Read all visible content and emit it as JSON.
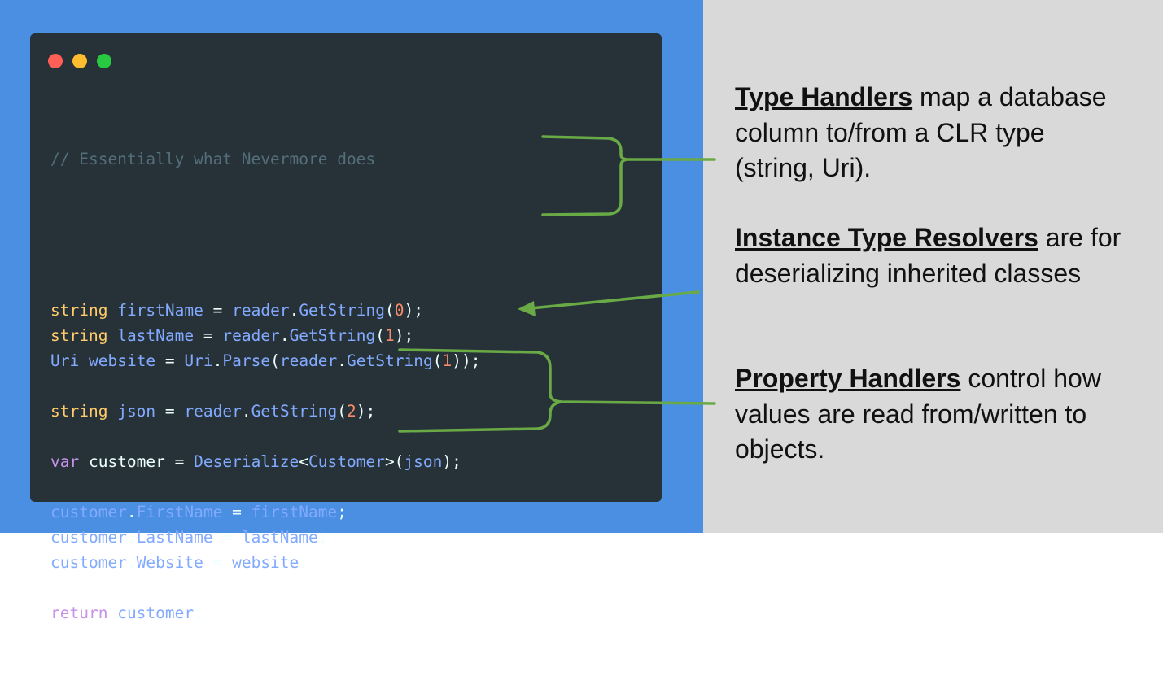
{
  "colors": {
    "left_bg": "#4a8fe2",
    "right_bg": "#d9d9d9",
    "code_bg": "#263238",
    "arrow": "#6aaa46"
  },
  "window_controls": [
    "close",
    "minimize",
    "maximize"
  ],
  "code": {
    "comment": "// Essentially what Nevermore does",
    "lines": [
      [
        [
          "t-type",
          "string"
        ],
        [
          "t-punc",
          " "
        ],
        [
          "t-var",
          "firstName"
        ],
        [
          "t-punc",
          " = "
        ],
        [
          "t-var",
          "reader"
        ],
        [
          "t-punc",
          "."
        ],
        [
          "t-fn",
          "GetString"
        ],
        [
          "t-punc",
          "("
        ],
        [
          "t-num",
          "0"
        ],
        [
          "t-punc",
          ");"
        ]
      ],
      [
        [
          "t-type",
          "string"
        ],
        [
          "t-punc",
          " "
        ],
        [
          "t-var",
          "lastName"
        ],
        [
          "t-punc",
          " = "
        ],
        [
          "t-var",
          "reader"
        ],
        [
          "t-punc",
          "."
        ],
        [
          "t-fn",
          "GetString"
        ],
        [
          "t-punc",
          "("
        ],
        [
          "t-num",
          "1"
        ],
        [
          "t-punc",
          ");"
        ]
      ],
      [
        [
          "t-var",
          "Uri"
        ],
        [
          "t-punc",
          " "
        ],
        [
          "t-var",
          "website"
        ],
        [
          "t-punc",
          " = "
        ],
        [
          "t-var",
          "Uri"
        ],
        [
          "t-punc",
          "."
        ],
        [
          "t-fn",
          "Parse"
        ],
        [
          "t-punc",
          "("
        ],
        [
          "t-var",
          "reader"
        ],
        [
          "t-punc",
          "."
        ],
        [
          "t-fn",
          "GetString"
        ],
        [
          "t-punc",
          "("
        ],
        [
          "t-num",
          "1"
        ],
        [
          "t-punc",
          "));"
        ]
      ],
      [],
      [
        [
          "t-type",
          "string"
        ],
        [
          "t-punc",
          " "
        ],
        [
          "t-var",
          "json"
        ],
        [
          "t-punc",
          " = "
        ],
        [
          "t-var",
          "reader"
        ],
        [
          "t-punc",
          "."
        ],
        [
          "t-fn",
          "GetString"
        ],
        [
          "t-punc",
          "("
        ],
        [
          "t-num",
          "2"
        ],
        [
          "t-punc",
          ");"
        ]
      ],
      [],
      [
        [
          "t-kw",
          "var"
        ],
        [
          "t-punc",
          " customer = "
        ],
        [
          "t-fn",
          "Deserialize"
        ],
        [
          "t-punc",
          "<"
        ],
        [
          "t-var",
          "Customer"
        ],
        [
          "t-punc",
          ">("
        ],
        [
          "t-var",
          "json"
        ],
        [
          "t-punc",
          ");"
        ]
      ],
      [],
      [
        [
          "t-var",
          "customer"
        ],
        [
          "t-punc",
          "."
        ],
        [
          "t-var",
          "FirstName"
        ],
        [
          "t-punc",
          " = "
        ],
        [
          "t-var",
          "firstName"
        ],
        [
          "t-punc",
          ";"
        ]
      ],
      [
        [
          "t-var",
          "customer"
        ],
        [
          "t-punc",
          "."
        ],
        [
          "t-var",
          "LastName"
        ],
        [
          "t-punc",
          " = "
        ],
        [
          "t-var",
          "lastName"
        ],
        [
          "t-punc",
          ";"
        ]
      ],
      [
        [
          "t-var",
          "customer"
        ],
        [
          "t-punc",
          "."
        ],
        [
          "t-var",
          "Website"
        ],
        [
          "t-punc",
          " = "
        ],
        [
          "t-var",
          "website"
        ],
        [
          "t-punc",
          ";"
        ]
      ],
      [],
      [
        [
          "t-kw",
          "return"
        ],
        [
          "t-punc",
          " "
        ],
        [
          "t-var",
          "customer"
        ],
        [
          "t-punc",
          ";"
        ]
      ]
    ]
  },
  "annotations": {
    "type_handlers": {
      "title": "Type Handlers",
      "text": " map a database column to/from a CLR type (string, Uri)."
    },
    "instance_resolvers": {
      "title": "Instance Type Resolvers",
      "text": " are for deserializing inherited classes"
    },
    "property_handlers": {
      "title": "Property Handlers",
      "text": " control how values are read from/written to objects."
    }
  }
}
